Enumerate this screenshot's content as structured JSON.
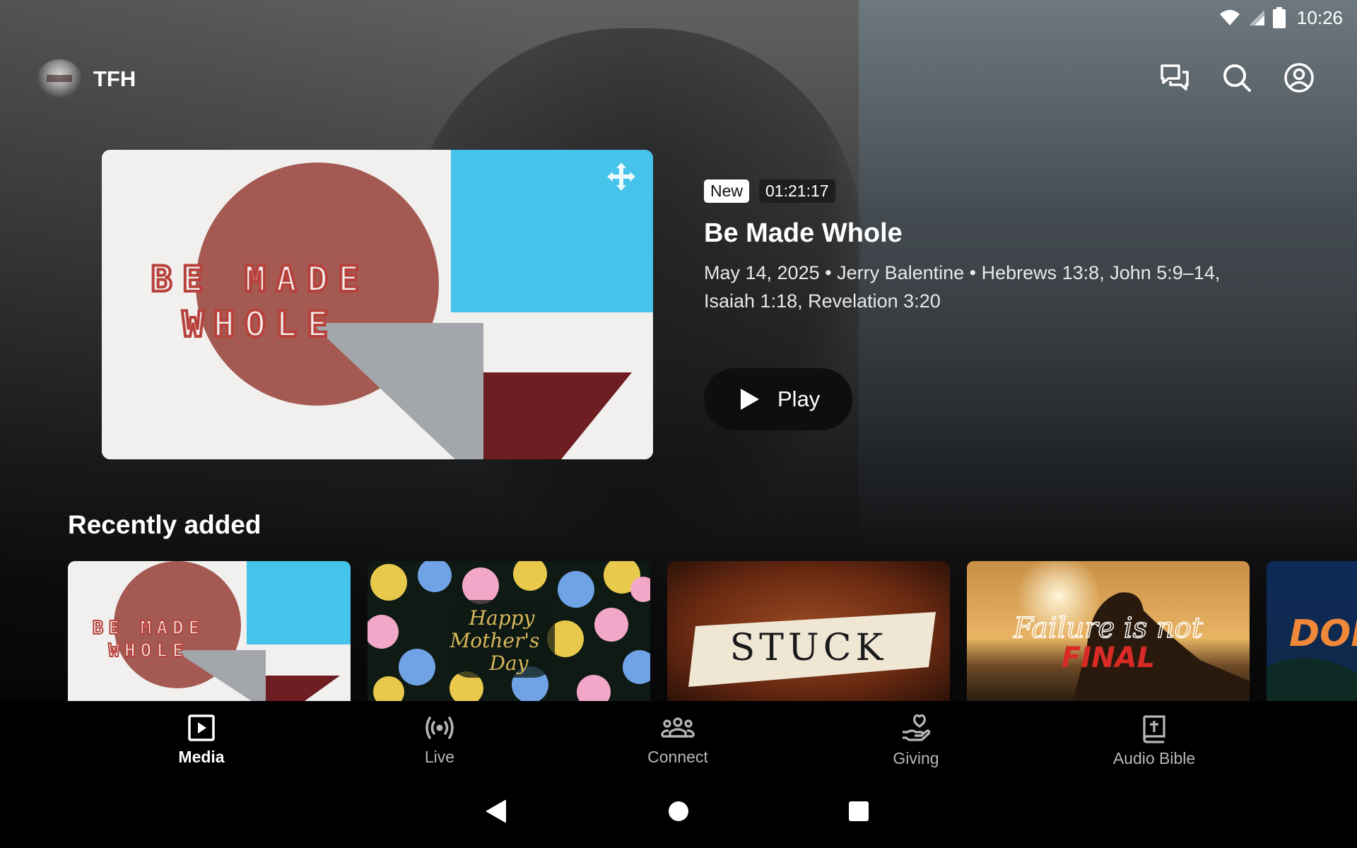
{
  "status_bar": {
    "time": "10:26"
  },
  "header": {
    "app_title": "TFH"
  },
  "featured": {
    "art_line1": "BE MADE",
    "art_line2": "WHOLE",
    "badge_new": "New",
    "duration": "01:21:17",
    "title": "Be Made Whole",
    "description": "May 14, 2025 • Jerry Balentine • Hebrews 13:8, John 5:9–14, Isaiah 1:18, Revelation 3:20",
    "play_label": "Play"
  },
  "recently_added": {
    "title": "Recently added",
    "cards": [
      {
        "line1": "BE MADE",
        "line2": "WHOLE"
      },
      {
        "line1": "Happy",
        "line2": "Mother's",
        "line3": "Day"
      },
      {
        "line1": "STUCK"
      },
      {
        "line1": "Failure is not",
        "line2": "FINAL"
      },
      {
        "line1": "DON"
      }
    ]
  },
  "bottom_nav": {
    "items": [
      {
        "label": "Media",
        "icon": "play-box-icon",
        "active": true
      },
      {
        "label": "Live",
        "icon": "broadcast-icon",
        "active": false
      },
      {
        "label": "Connect",
        "icon": "people-group-icon",
        "active": false
      },
      {
        "label": "Giving",
        "icon": "hand-heart-icon",
        "active": false
      },
      {
        "label": "Audio Bible",
        "icon": "bible-cross-icon",
        "active": false
      }
    ]
  },
  "system_nav": {
    "buttons": [
      "back-icon",
      "home-icon",
      "recents-icon"
    ]
  },
  "colors": {
    "art_red": "#b8413c",
    "art_maroon": "#6e1d22",
    "art_blue": "#45c3ea",
    "art_gray": "#a3a6ab",
    "art_circle": "#a45a52"
  }
}
